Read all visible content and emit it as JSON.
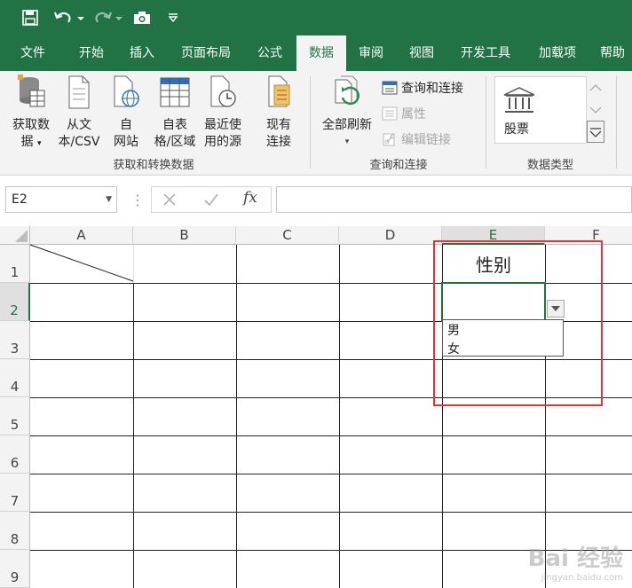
{
  "quick_access": {
    "icons": [
      "save-icon",
      "undo-icon",
      "redo-icon",
      "camera-icon",
      "customize-icon"
    ]
  },
  "tabs": [
    {
      "label": "文件",
      "active": false
    },
    {
      "label": "开始",
      "active": false
    },
    {
      "label": "插入",
      "active": false
    },
    {
      "label": "页面布局",
      "active": false
    },
    {
      "label": "公式",
      "active": false
    },
    {
      "label": "数据",
      "active": true
    },
    {
      "label": "审阅",
      "active": false
    },
    {
      "label": "视图",
      "active": false
    },
    {
      "label": "开发工具",
      "active": false
    },
    {
      "label": "加载项",
      "active": false
    },
    {
      "label": "帮助",
      "active": false
    }
  ],
  "ribbon": {
    "get_data": {
      "line1": "获取数",
      "line2": "据"
    },
    "from_csv": {
      "line1": "从文",
      "line2": "本/CSV"
    },
    "from_web": {
      "line1": "自",
      "line2": "网站"
    },
    "from_table": {
      "line1": "自表",
      "line2": "格/区域"
    },
    "recent_sources": {
      "line1": "最近使",
      "line2": "用的源"
    },
    "existing_conn": {
      "line1": "现有",
      "line2": "连接"
    },
    "group1_label": "获取和转换数据",
    "refresh_all": {
      "line1": "全部刷新"
    },
    "queries_connections": "查询和连接",
    "properties": "属性",
    "edit_links": "编辑链接",
    "group2_label": "查询和连接",
    "stocks": "股票",
    "group3_label": "数据类型"
  },
  "formula_bar": {
    "name_box": "E2",
    "fx": "fx",
    "formula": ""
  },
  "grid": {
    "columns": [
      "A",
      "B",
      "C",
      "D",
      "E",
      "F"
    ],
    "rows": [
      "1",
      "2",
      "3",
      "4",
      "5",
      "6",
      "7",
      "8",
      "9"
    ],
    "selected_column": "E",
    "selected_row": "2",
    "header_cell_E1": "性别",
    "dropdown_options": [
      "男",
      "女"
    ]
  },
  "watermark": {
    "main": "Bai 经验",
    "sub": "jingyan.baidu.com"
  },
  "colors": {
    "excel_green": "#217346",
    "highlight_red": "#d9373a"
  }
}
